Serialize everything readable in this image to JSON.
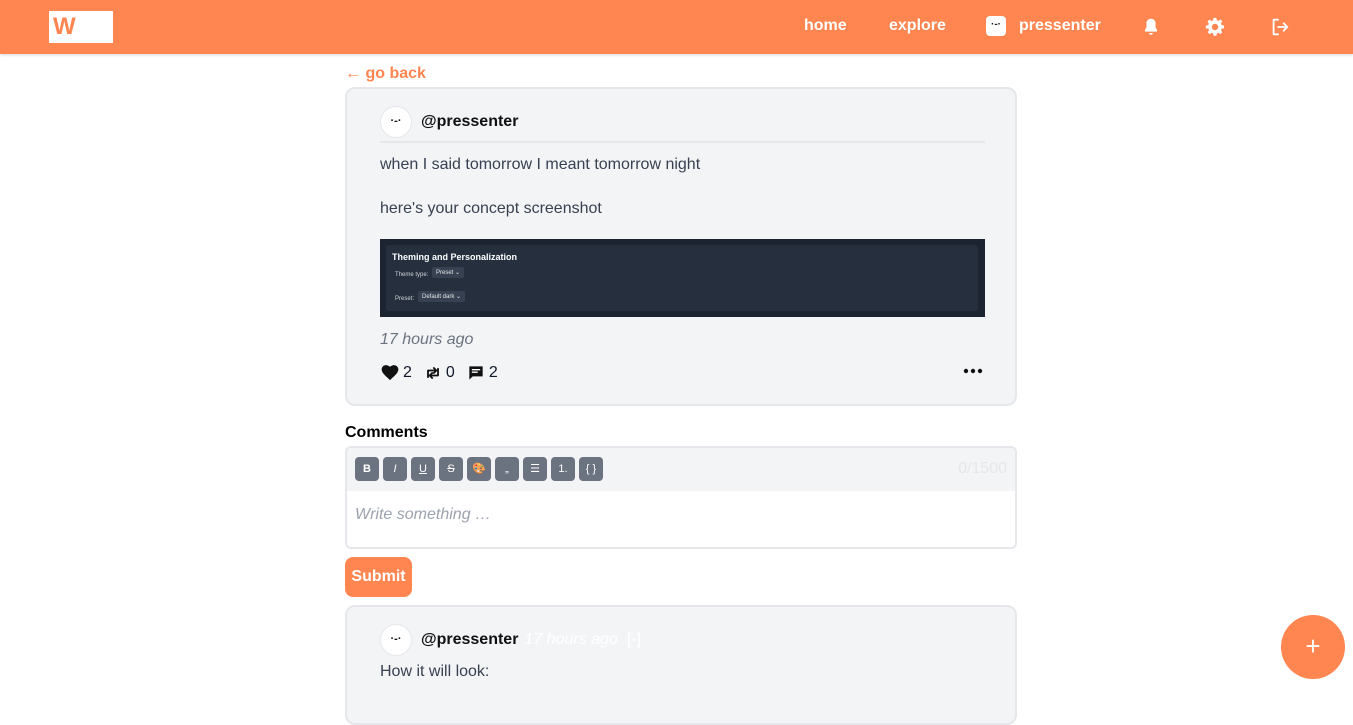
{
  "header": {
    "logo_text": "W",
    "nav_home": "home",
    "nav_explore": "explore",
    "nav_user": "pressenter",
    "nav_avatar_face": "·-·",
    "icons": [
      "bell-icon",
      "gear-icon",
      "logout-icon"
    ]
  },
  "go_back": "← go back",
  "post": {
    "avatar_face": "·-·",
    "author": "@pressenter",
    "line1": "when I said tomorrow I meant tomorrow night",
    "line2": "here's your concept screenshot",
    "image": {
      "title": "Theming and Personalization",
      "theme_type_label": "Theme type:",
      "theme_type_value": "Preset ⌄",
      "preset_label": "Preset:",
      "preset_value": "Default dark ⌄"
    },
    "timestamp": "17 hours ago",
    "likes": "2",
    "reposts": "0",
    "comments": "2"
  },
  "comments_heading": "Comments",
  "editor": {
    "tools": [
      "B",
      "I",
      "U",
      "S",
      "🎨",
      "„",
      "☰",
      "1.",
      "{ }"
    ],
    "char_count": "0/1500",
    "placeholder": "Write something …"
  },
  "submit_label": "Submit",
  "comment": {
    "avatar_face": "·-·",
    "author": "@pressenter",
    "time": "17 hours ago",
    "toggle": "[-]",
    "text": "How it will look:"
  },
  "fab_label": "+",
  "colors": {
    "accent": "#ff8650",
    "card_bg": "#f3f4f6",
    "border": "#e5e7eb",
    "tool_bg": "#6b7280"
  }
}
